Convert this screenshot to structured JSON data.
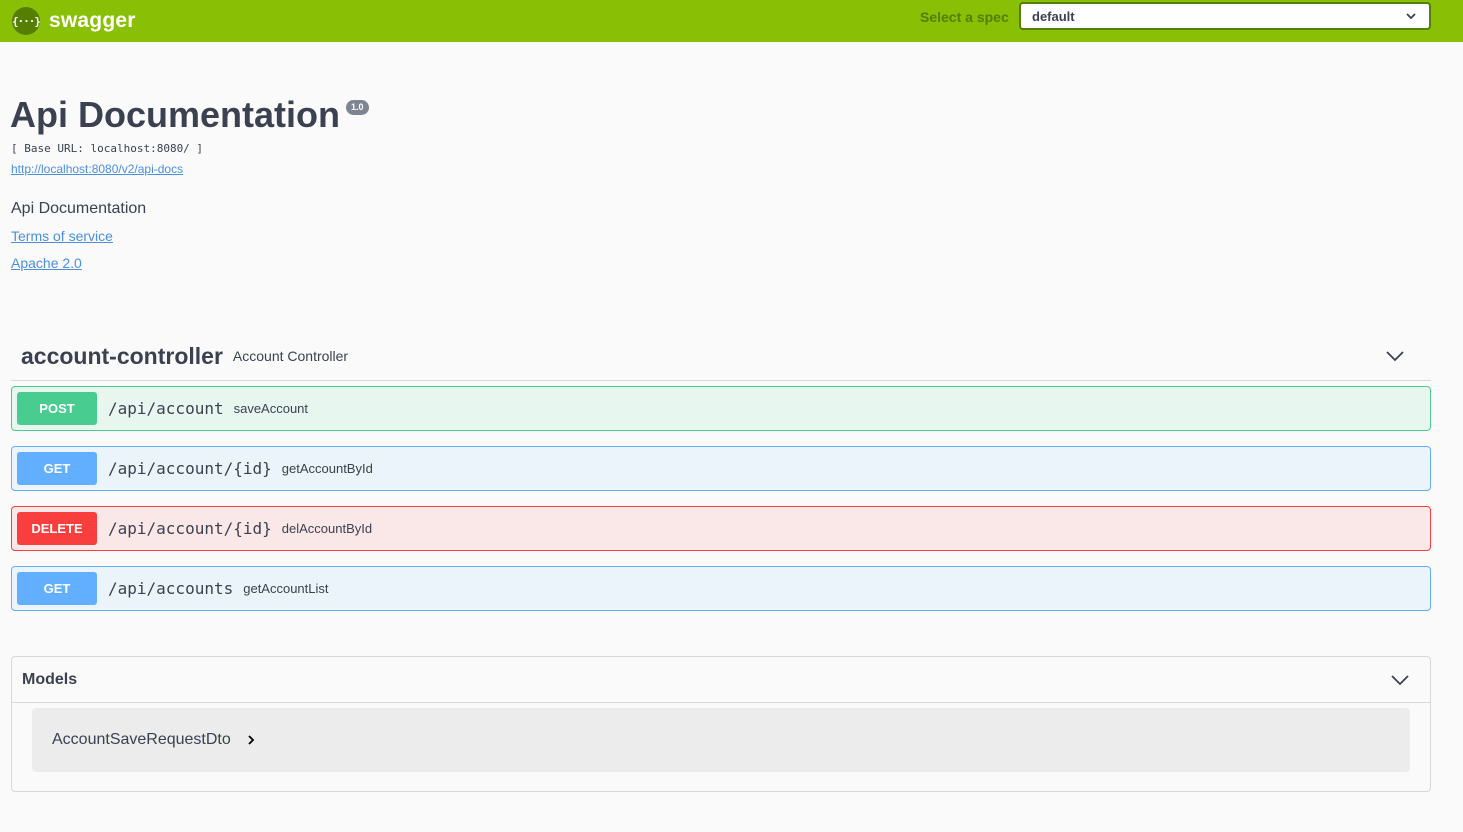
{
  "topbar": {
    "logo_icon": "{···}",
    "logo_text": "swagger",
    "spec_label": "Select a spec",
    "spec_value": "default",
    "colors": {
      "bar": "#89bf04",
      "dark": "#547f00"
    }
  },
  "info": {
    "title": "Api Documentation",
    "version": "1.0",
    "base_url": "[ Base URL: localhost:8080/ ]",
    "api_docs_link": "http://localhost:8080/v2/api-docs",
    "description": "Api Documentation",
    "terms_link": "Terms of service",
    "license_link": "Apache 2.0"
  },
  "tag": {
    "name": "account-controller",
    "description": "Account Controller",
    "toggle_icon": "chevron-down-icon"
  },
  "operations": [
    {
      "method": "POST",
      "path": "/api/account",
      "summary": "saveAccount",
      "color": "#49cc90"
    },
    {
      "method": "GET",
      "path": "/api/account/{id}",
      "summary": "getAccountById",
      "color": "#61affe"
    },
    {
      "method": "DELETE",
      "path": "/api/account/{id}",
      "summary": "delAccountById",
      "color": "#f93e3e"
    },
    {
      "method": "GET",
      "path": "/api/accounts",
      "summary": "getAccountList",
      "color": "#61affe"
    }
  ],
  "models": {
    "title": "Models",
    "toggle_icon": "chevron-down-icon",
    "items": [
      {
        "name": "AccountSaveRequestDto",
        "icon": "chevron-right-icon"
      }
    ]
  }
}
